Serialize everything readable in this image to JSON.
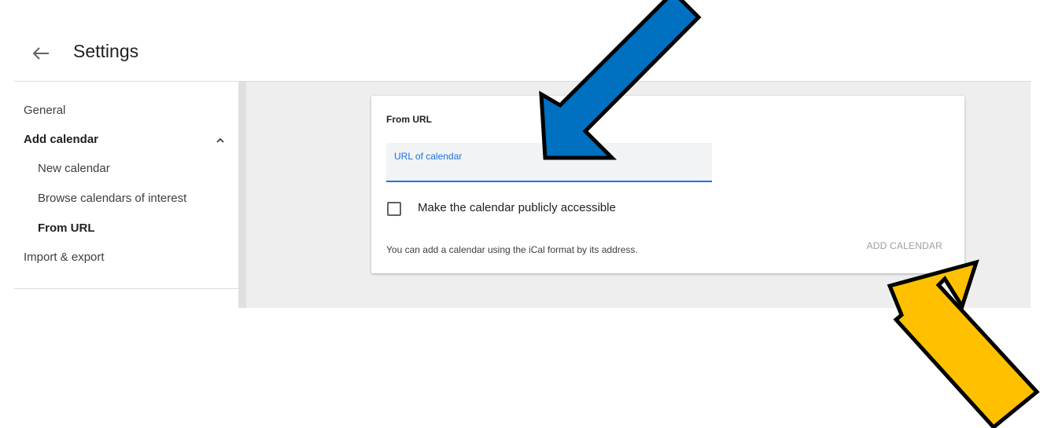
{
  "header": {
    "back_icon": "arrow-left-icon",
    "title": "Settings"
  },
  "sidebar": {
    "items": [
      {
        "label": "General"
      },
      {
        "label": "Add calendar",
        "expanded": true,
        "icon": "chevron-up-icon"
      },
      {
        "label": "New calendar"
      },
      {
        "label": "Browse calendars of interest"
      },
      {
        "label": "From URL",
        "selected": true
      },
      {
        "label": "Import & export"
      }
    ]
  },
  "card": {
    "title": "From URL",
    "url_field": {
      "label": "URL of calendar",
      "value": ""
    },
    "checkbox": {
      "label": "Make the calendar publicly accessible",
      "checked": false
    },
    "help_text": "You can add a calendar using the iCal format by its address.",
    "add_button_label": "ADD CALENDAR"
  },
  "annotations": {
    "blue_arrow_color": "#0070c0",
    "yellow_arrow_color": "#ffc000"
  },
  "colors": {
    "accent": "#1a73e8",
    "main_background": "#eeeeee",
    "disabled_text": "#9aa0a6"
  }
}
